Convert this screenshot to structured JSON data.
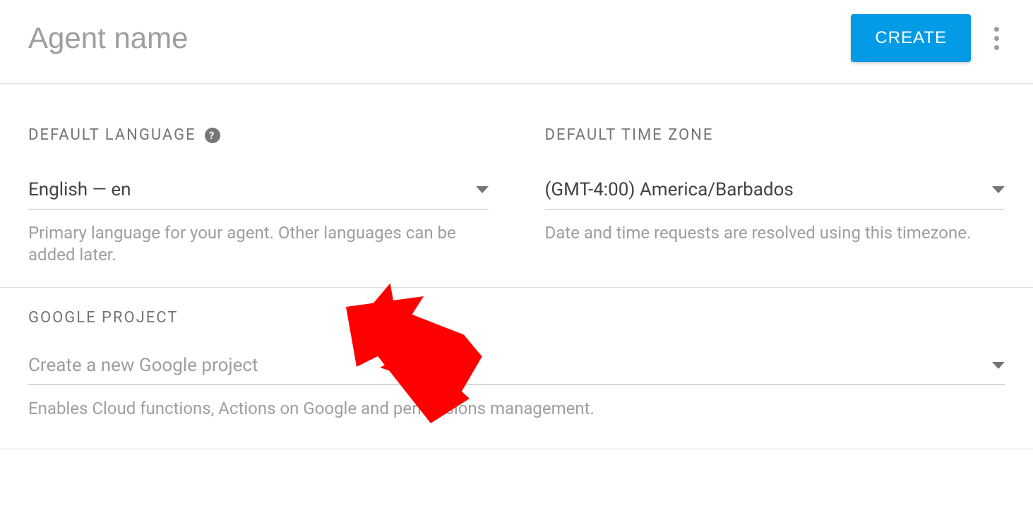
{
  "header": {
    "agent_name_placeholder": "Agent name",
    "create_label": "CREATE"
  },
  "language_section": {
    "label": "DEFAULT LANGUAGE",
    "value": "English — en",
    "hint": "Primary language for your agent. Other languages can be added later."
  },
  "timezone_section": {
    "label": "DEFAULT TIME ZONE",
    "value": "(GMT-4:00) America/Barbados",
    "hint": "Date and time requests are resolved using this timezone."
  },
  "project_section": {
    "label": "GOOGLE PROJECT",
    "placeholder": "Create a new Google project",
    "hint": "Enables Cloud functions, Actions on Google and permissions management."
  }
}
